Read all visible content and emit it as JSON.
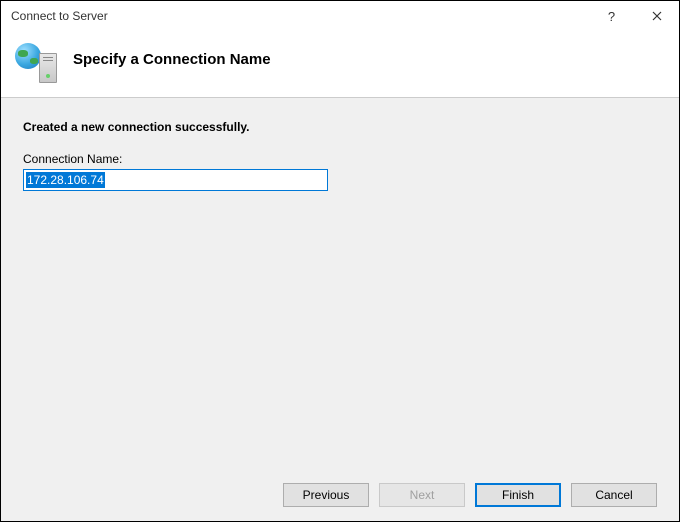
{
  "window": {
    "title": "Connect to Server"
  },
  "header": {
    "title": "Specify a Connection Name"
  },
  "body": {
    "status": "Created a new connection successfully.",
    "field_label": "Connection Name:",
    "field_value": "172.28.106.74"
  },
  "buttons": {
    "previous": "Previous",
    "next": "Next",
    "finish": "Finish",
    "cancel": "Cancel"
  }
}
